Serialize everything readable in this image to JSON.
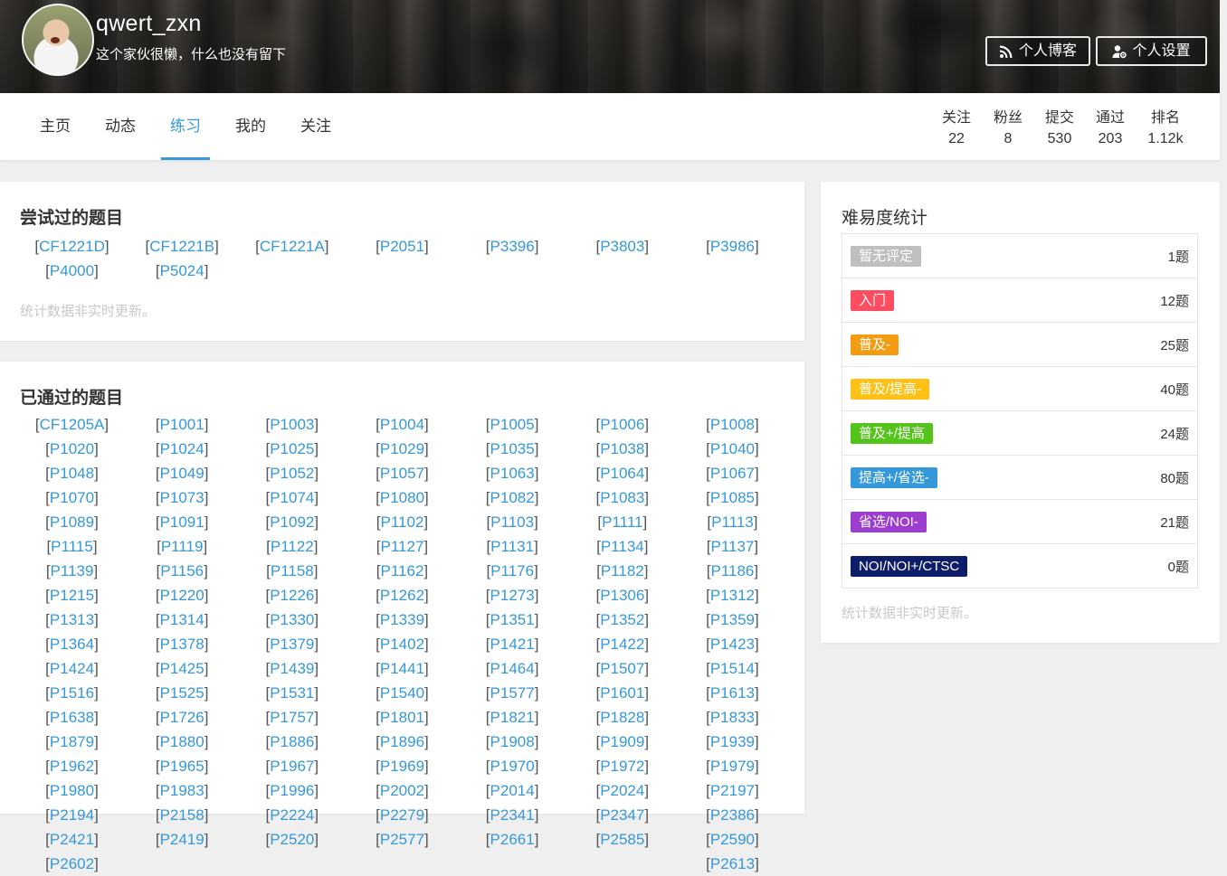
{
  "header": {
    "username": "qwert_zxn",
    "signature": "这个家伙很懒，什么也没有留下",
    "blog_button": "个人博客",
    "settings_button": "个人设置"
  },
  "nav": {
    "tabs": [
      "主页",
      "动态",
      "练习",
      "我的",
      "关注"
    ],
    "active_tab": "练习"
  },
  "stats": [
    {
      "label": "关注",
      "value": "22"
    },
    {
      "label": "粉丝",
      "value": "8"
    },
    {
      "label": "提交",
      "value": "530"
    },
    {
      "label": "通过",
      "value": "203"
    },
    {
      "label": "排名",
      "value": "1.12k"
    }
  ],
  "tried": {
    "title": "尝试过的题目",
    "problems": [
      "CF1221D",
      "CF1221B",
      "CF1221A",
      "P2051",
      "P3396",
      "P3803",
      "P3986",
      "P4000",
      "P5024"
    ],
    "note": "统计数据非实时更新。"
  },
  "passed": {
    "title": "已通过的题目",
    "problems": [
      "CF1205A",
      "P1001",
      "P1003",
      "P1004",
      "P1005",
      "P1006",
      "P1008",
      "P1020",
      "P1024",
      "P1025",
      "P1029",
      "P1035",
      "P1038",
      "P1040",
      "P1048",
      "P1049",
      "P1052",
      "P1057",
      "P1063",
      "P1064",
      "P1067",
      "P1070",
      "P1073",
      "P1074",
      "P1080",
      "P1082",
      "P1083",
      "P1085",
      "P1089",
      "P1091",
      "P1092",
      "P1102",
      "P1103",
      "P1111",
      "P1113",
      "P1115",
      "P1119",
      "P1122",
      "P1127",
      "P1131",
      "P1134",
      "P1137",
      "P1139",
      "P1156",
      "P1158",
      "P1162",
      "P1176",
      "P1182",
      "P1186",
      "P1215",
      "P1220",
      "P1226",
      "P1262",
      "P1273",
      "P1306",
      "P1312",
      "P1313",
      "P1314",
      "P1330",
      "P1339",
      "P1351",
      "P1352",
      "P1359",
      "P1364",
      "P1378",
      "P1379",
      "P1402",
      "P1421",
      "P1422",
      "P1423",
      "P1424",
      "P1425",
      "P1439",
      "P1441",
      "P1464",
      "P1507",
      "P1514",
      "P1516",
      "P1525",
      "P1531",
      "P1540",
      "P1577",
      "P1601",
      "P1613",
      "P1638",
      "P1726",
      "P1757",
      "P1801",
      "P1821",
      "P1828",
      "P1833",
      "P1879",
      "P1880",
      "P1886",
      "P1896",
      "P1908",
      "P1909",
      "P1939",
      "P1962",
      "P1965",
      "P1967",
      "P1969",
      "P1970",
      "P1972",
      "P1979",
      "P1980",
      "P1983",
      "P1996",
      "P2002",
      "P2014",
      "P2024",
      "P2197",
      "P2194",
      "P2158",
      "P2224",
      "P2279",
      "P2341",
      "P2347",
      "P2386",
      "P2421",
      "P2419",
      "P2520",
      "P2577",
      "P2661",
      "P2585",
      "P2590",
      "P2602",
      "P2613"
    ]
  },
  "difficulty": {
    "title": "难易度统计",
    "rows": [
      {
        "label": "暂无评定",
        "count": "1题",
        "color": "#bfbfbf"
      },
      {
        "label": "入门",
        "count": "12题",
        "color": "#fe4c61"
      },
      {
        "label": "普及-",
        "count": "25题",
        "color": "#f39c11"
      },
      {
        "label": "普及/提高-",
        "count": "40题",
        "color": "#ffc116"
      },
      {
        "label": "普及+/提高",
        "count": "24题",
        "color": "#52c41a"
      },
      {
        "label": "提高+/省选-",
        "count": "80题",
        "color": "#3498db"
      },
      {
        "label": "省选/NOI-",
        "count": "21题",
        "color": "#9d3dcf"
      },
      {
        "label": "NOI/NOI+/CTSC",
        "count": "0题",
        "color": "#0e1d69"
      }
    ],
    "note": "统计数据非实时更新。"
  }
}
